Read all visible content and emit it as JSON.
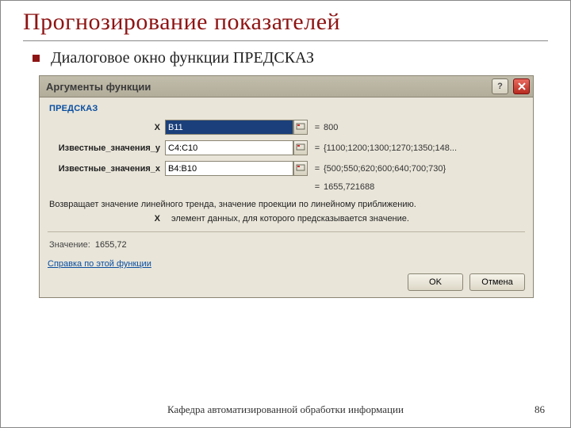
{
  "slide": {
    "title": "Прогнозирование  показателей",
    "subtitle": "Диалоговое окно функции ПРЕДСКАЗ",
    "footer_text": "Кафедра автоматизированной обработки информации",
    "page_number": "86"
  },
  "dialog": {
    "title": "Аргументы функции",
    "help_btn": "?",
    "close_btn": "✕",
    "function_name": "ПРЕДСКАЗ",
    "args": [
      {
        "label": "X",
        "value": "B11",
        "selected": true,
        "result": "800"
      },
      {
        "label": "Известные_значения_y",
        "value": "C4:C10",
        "selected": false,
        "result": "{1100;1200;1300;1270;1350;148..."
      },
      {
        "label": "Известные_значения_x",
        "value": "B4:B10",
        "selected": false,
        "result": "{500;550;620;600;640;700;730}"
      }
    ],
    "eq": "=",
    "computed_result": "1655,721688",
    "description": "Возвращает значение линейного тренда, значение проекции по линейному приближению.",
    "arg_hint_label": "X",
    "arg_hint_text": "элемент данных, для которого предсказывается значение.",
    "value_label": "Значение:",
    "value_value": "1655,72",
    "help_link": "Справка по этой функции",
    "ok": "OK",
    "cancel": "Отмена"
  }
}
